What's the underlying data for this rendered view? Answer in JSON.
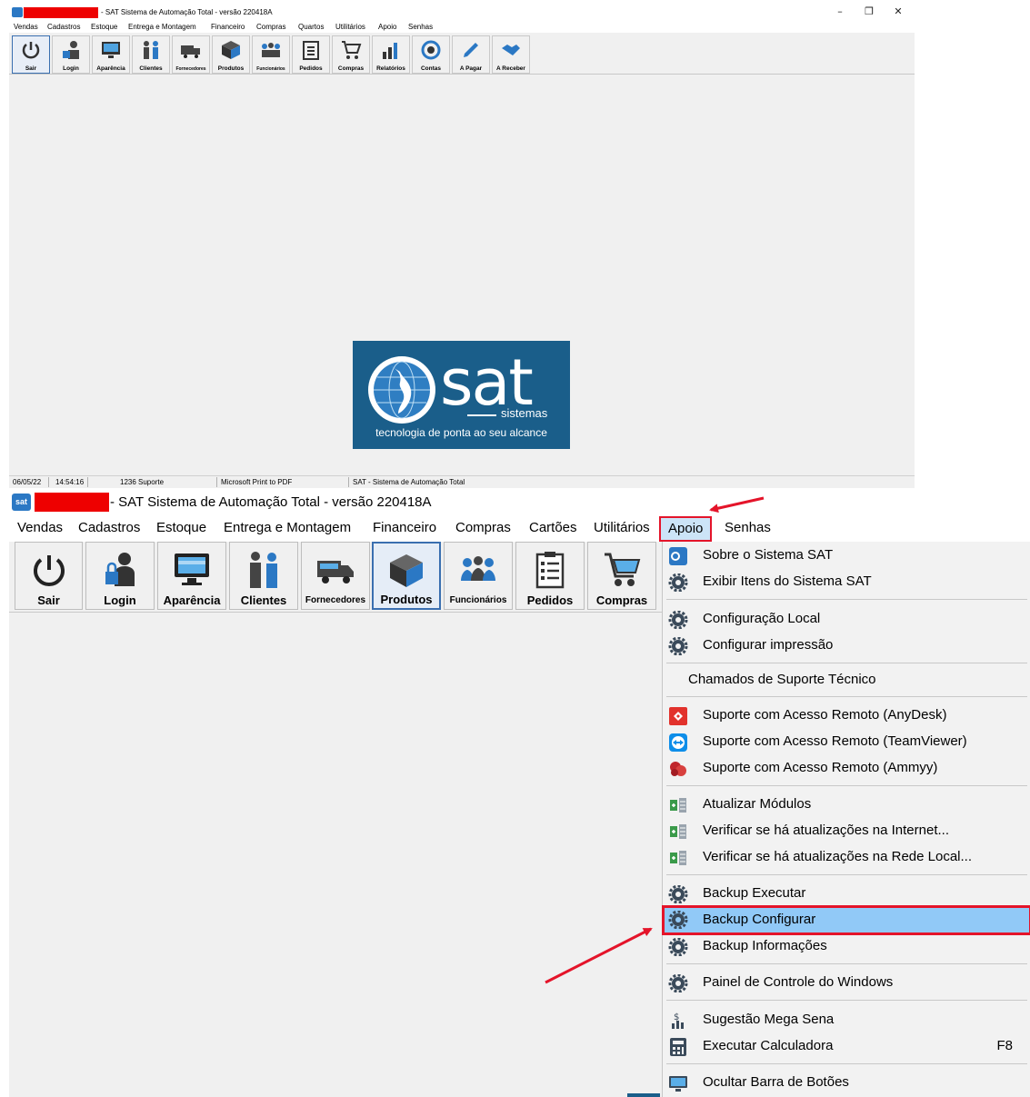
{
  "small_window": {
    "title": "- SAT Sistema de Automação Total - versão 220418A",
    "menu": [
      "Vendas",
      "Cadastros",
      "Estoque",
      "Entrega e Montagem",
      "Financeiro",
      "Compras",
      "Quartos",
      "Utilitários",
      "Apoio",
      "Senhas"
    ],
    "toolbar": [
      "Sair",
      "Login",
      "Aparência",
      "Clientes",
      "Fornecedores",
      "Produtos",
      "Funcionários",
      "Pedidos",
      "Compras",
      "Relatórios",
      "Contas",
      "A Pagar",
      "A Receber"
    ],
    "logo": {
      "word": "sat",
      "sub": "sistemas",
      "tagline": "tecnologia de ponta ao seu alcance"
    },
    "status": {
      "date": "06/05/22",
      "time": "14:54:16",
      "user": "1236 Suporte",
      "printer": "Microsoft Print to PDF",
      "app": "SAT - Sistema de Automação Total"
    }
  },
  "large_window": {
    "title": "- SAT Sistema de Automação Total - versão 220418A",
    "menu": [
      "Vendas",
      "Cadastros",
      "Estoque",
      "Entrega e Montagem",
      "Financeiro",
      "Compras",
      "Cartões",
      "Utilitários",
      "Apoio",
      "Senhas"
    ],
    "toolbar": [
      "Sair",
      "Login",
      "Aparência",
      "Clientes",
      "Fornecedores",
      "Produtos",
      "Funcionários",
      "Pedidos",
      "Compras"
    ],
    "apoio_menu": [
      {
        "label": "Sobre o Sistema SAT",
        "icon": "sat-logo-icon"
      },
      {
        "label": "Exibir Itens do Sistema SAT",
        "icon": "gear-icon"
      },
      {
        "label": "Configuração Local",
        "icon": "gear-icon"
      },
      {
        "label": "Configurar impressão",
        "icon": "gear-icon"
      },
      {
        "label": "Chamados de Suporte Técnico",
        "icon": ""
      },
      {
        "label": "Suporte com Acesso Remoto (AnyDesk)",
        "icon": "anydesk-icon"
      },
      {
        "label": "Suporte com Acesso Remoto (TeamViewer)",
        "icon": "teamviewer-icon"
      },
      {
        "label": "Suporte com Acesso Remoto (Ammyy)",
        "icon": "ammyy-icon"
      },
      {
        "label": "Atualizar Módulos",
        "icon": "update-icon"
      },
      {
        "label": "Verificar se há atualizações na Internet...",
        "icon": "update-icon"
      },
      {
        "label": "Verificar se há atualizações na Rede Local...",
        "icon": "update-icon"
      },
      {
        "label": "Backup Executar",
        "icon": "gear-icon"
      },
      {
        "label": "Backup Configurar",
        "icon": "gear-icon"
      },
      {
        "label": "Backup Informações",
        "icon": "gear-icon"
      },
      {
        "label": "Painel de Controle do Windows",
        "icon": "gear-icon"
      },
      {
        "label": "Sugestão Mega Sena",
        "icon": "money-icon"
      },
      {
        "label": "Executar Calculadora",
        "icon": "calculator-icon",
        "shortcut": "F8"
      },
      {
        "label": "Ocultar Barra de Botões",
        "icon": "monitor-icon"
      }
    ],
    "highlight_color": "#e4142a",
    "selected_item": "Backup Configurar"
  }
}
